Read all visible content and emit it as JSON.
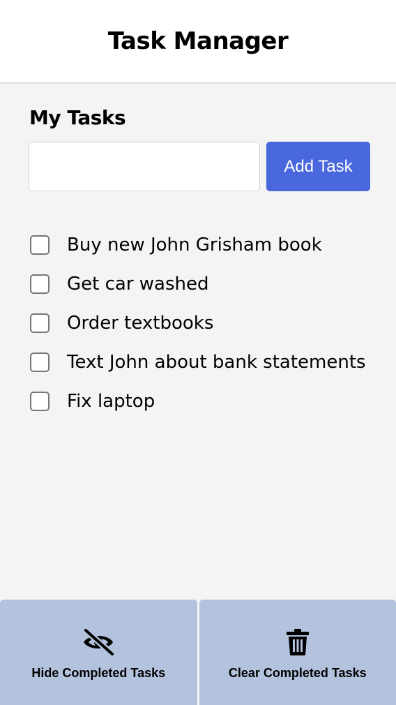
{
  "header": {
    "title": "Task Manager"
  },
  "tasks_section": {
    "title": "My Tasks"
  },
  "new_task": {
    "value": "",
    "placeholder": ""
  },
  "add_button": {
    "label": "Add Task"
  },
  "tasks": [
    {
      "label": "Buy new John Grisham book",
      "completed": false
    },
    {
      "label": "Get car washed",
      "completed": false
    },
    {
      "label": "Order textbooks",
      "completed": false
    },
    {
      "label": "Text John about bank statements",
      "completed": false
    },
    {
      "label": "Fix laptop",
      "completed": false
    }
  ],
  "footer": {
    "hide_completed": {
      "label": "Hide Completed Tasks",
      "icon": "eye-slash-icon"
    },
    "clear_completed": {
      "label": "Clear Completed Tasks",
      "icon": "trash-icon"
    }
  },
  "colors": {
    "accent": "#4a68dd",
    "footer_bg": "#b3c3de",
    "page_bg": "#f4f4f5",
    "header_bg": "#ffffff"
  }
}
